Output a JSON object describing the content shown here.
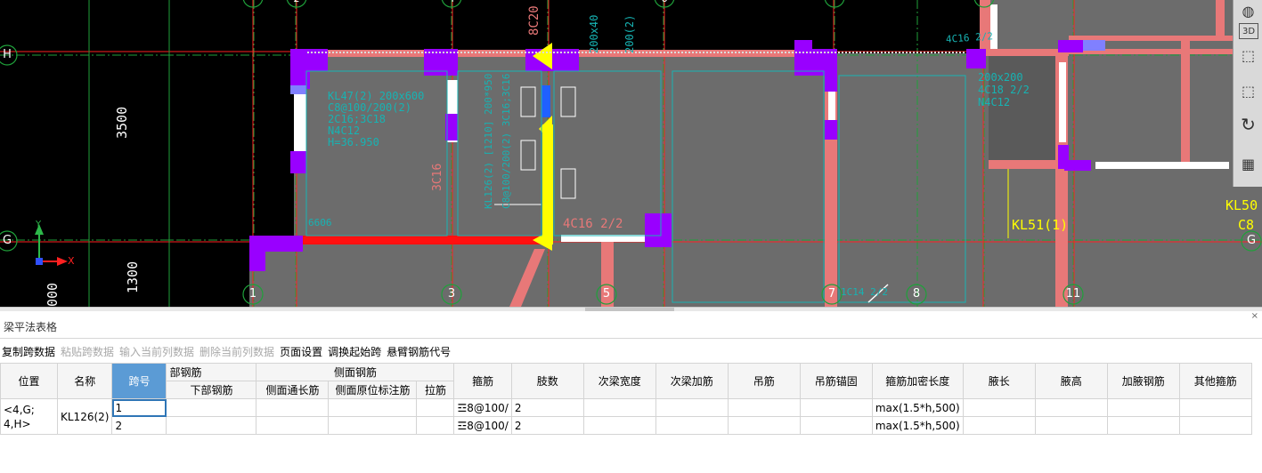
{
  "cad": {
    "axis_labels": {
      "H": "H",
      "G": "G",
      "n1": "1",
      "n3": "3",
      "n5": "5",
      "n7": "7",
      "n8": "8",
      "n11": "11",
      "t2": "2",
      "t4": "4",
      "t6": "6"
    },
    "dims": {
      "d3500": "3500",
      "d1300": "1300",
      "d000": "000"
    },
    "ucs": {
      "x": "X",
      "y": "Y"
    },
    "labels": {
      "kl47": "KL47(2) 200x600",
      "kl47b": "C8@100/200(2)",
      "kl47c": "2C16;3C18",
      "kl47d": "N4C12",
      "kl47e": "H=36.950",
      "c8c20": "8C20 4",
      "c3c16": "3C16",
      "kl126": "KL126(2) [1210] 200*950",
      "kl126b": "C8@100/200(2) 3C16;3C16",
      "kl_top": "200x40",
      "kl_top2": "200(2)",
      "c4c16": "4C16 2/2",
      "kl51": "KL51(1)",
      "kl50": "KL50",
      "c8_right": "C8",
      "top_right": "4C16 2/2",
      "right1": "200x200",
      "right2": "4C18 2/2",
      "right3": "N4C12",
      "bot7": "1C14 2/2",
      "n6606": "6606"
    },
    "colors": {
      "beam": "#e87878",
      "column": "#9900ff",
      "select": "#ffff00",
      "slab": "#6c6c6c",
      "axis": "#ff2020"
    }
  },
  "viewbar": {
    "v3d": "3D"
  },
  "panel": {
    "title": "梁平法表格",
    "close": "×",
    "toolbar": [
      {
        "label": "复制跨数据",
        "enabled": true
      },
      {
        "label": "粘贴跨数据",
        "enabled": false
      },
      {
        "label": "输入当前列数据",
        "enabled": false
      },
      {
        "label": "删除当前列数据",
        "enabled": false
      },
      {
        "label": "页面设置",
        "enabled": true
      },
      {
        "label": "调换起始跨",
        "enabled": true
      },
      {
        "label": "悬臂钢筋代号",
        "enabled": true
      }
    ]
  },
  "table": {
    "headers": {
      "position": "位置",
      "name": "名称",
      "span": "跨号",
      "bottom_group": "部钢筋",
      "bottom": "下部钢筋",
      "side_group": "侧面钢筋",
      "side_through": "侧面通长筋",
      "side_orig": "侧面原位标注筋",
      "tie": "拉筋",
      "stirrup": "箍筋",
      "legs": "肢数",
      "sec_width": "次梁宽度",
      "sec_add": "次梁加筋",
      "hanger": "吊筋",
      "hanger_anchor": "吊筋锚固",
      "dense_len": "箍筋加密长度",
      "haunch_len": "腋长",
      "haunch_h": "腋高",
      "haunch_bar": "加腋钢筋",
      "other_stirrup": "其他箍筋"
    },
    "position": "<4,G;\n4,H>",
    "name": "KL126(2)",
    "rows": [
      {
        "span": "1",
        "stirrup": "☲8@100/",
        "legs": "2",
        "dense_len": "max(1.5*h,500)"
      },
      {
        "span": "2",
        "stirrup": "☲8@100/",
        "legs": "2",
        "dense_len": "max(1.5*h,500)"
      }
    ]
  }
}
